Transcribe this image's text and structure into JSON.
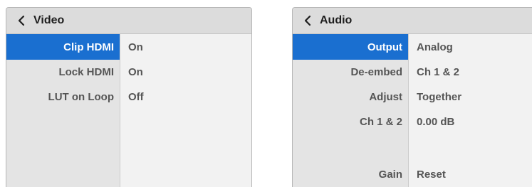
{
  "video": {
    "title": "Video",
    "rows": [
      {
        "label": "Clip HDMI",
        "value": "On",
        "selected": true
      },
      {
        "label": "Lock HDMI",
        "value": "On",
        "selected": false
      },
      {
        "label": "LUT on Loop",
        "value": "Off",
        "selected": false
      }
    ]
  },
  "audio": {
    "title": "Audio",
    "rows": [
      {
        "label": "Output",
        "value": "Analog",
        "selected": true
      },
      {
        "label": "De-embed",
        "value": "Ch 1 & 2",
        "selected": false
      },
      {
        "label": "Adjust",
        "value": "Together",
        "selected": false
      },
      {
        "label": "Ch 1 & 2",
        "value": "0.00 dB",
        "selected": false
      },
      {
        "label": "Gain",
        "value": "Reset",
        "selected": false
      }
    ]
  },
  "colors": {
    "selection": "#1a6fd0",
    "header_bg": "#dcdcdc",
    "label_col_bg": "#e4e4e4",
    "value_col_bg": "#f2f2f2"
  },
  "icons": {
    "back": "chevron-left-icon"
  }
}
